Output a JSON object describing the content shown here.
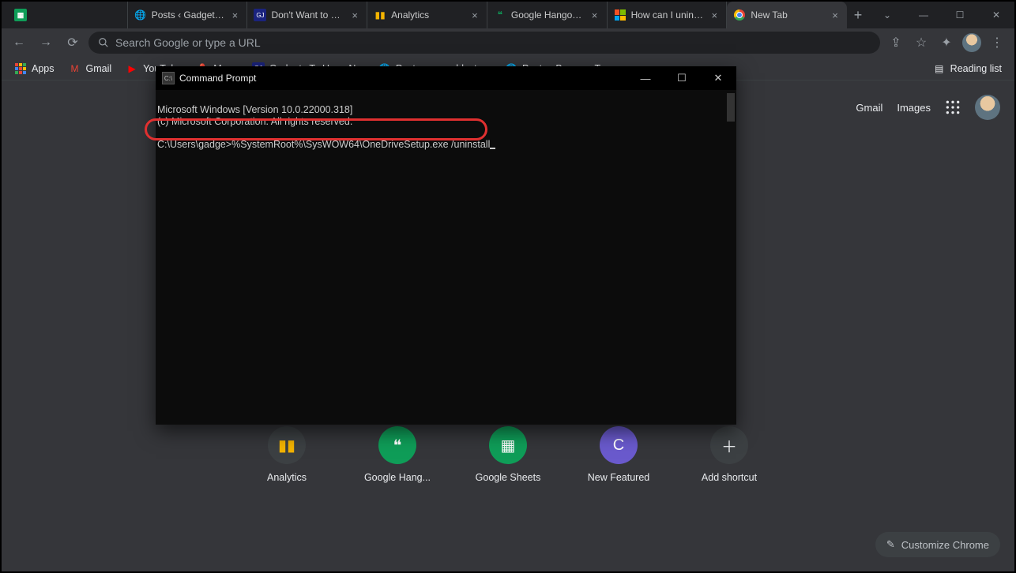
{
  "tabs": [
    {
      "title": "",
      "close": "×"
    },
    {
      "title": "Posts ‹ Gadgets To Use —",
      "close": "×"
    },
    {
      "title": "Don't Want to See YouTu",
      "close": "×"
    },
    {
      "title": "Analytics",
      "close": "×"
    },
    {
      "title": "Google Hangouts",
      "close": "×"
    },
    {
      "title": "How can I uninstall OneD",
      "close": "×"
    },
    {
      "title": "New Tab",
      "close": "×",
      "active": true
    }
  ],
  "toolbar": {
    "omnibox_placeholder": "Search Google or type a URL"
  },
  "bookmarks": [
    {
      "label": "Apps"
    },
    {
      "label": "Gmail"
    },
    {
      "label": "YouTube"
    },
    {
      "label": "Maps"
    },
    {
      "label": "Gadgets To Use - N..."
    },
    {
      "label": "Posts ‹ wearablesto..."
    },
    {
      "label": "Posts ‹ Browser To..."
    }
  ],
  "bookmarks_right": {
    "label": "Reading list"
  },
  "ntp": {
    "links": {
      "gmail": "Gmail",
      "images": "Images"
    },
    "shortcuts": [
      {
        "label": "Analytics"
      },
      {
        "label": "Google Hang..."
      },
      {
        "label": "Google Sheets"
      },
      {
        "label": "New Featured"
      },
      {
        "label": "Add shortcut"
      }
    ],
    "customize": "Customize Chrome"
  },
  "cmd": {
    "title": "Command Prompt",
    "line1": "Microsoft Windows [Version 10.0.22000.318]",
    "line2": "(c) Microsoft Corporation. All rights reserved.",
    "prompt": "C:\\Users\\gadge>",
    "command": "%SystemRoot%\\SysWOW64\\OneDriveSetup.exe /uninstall"
  }
}
